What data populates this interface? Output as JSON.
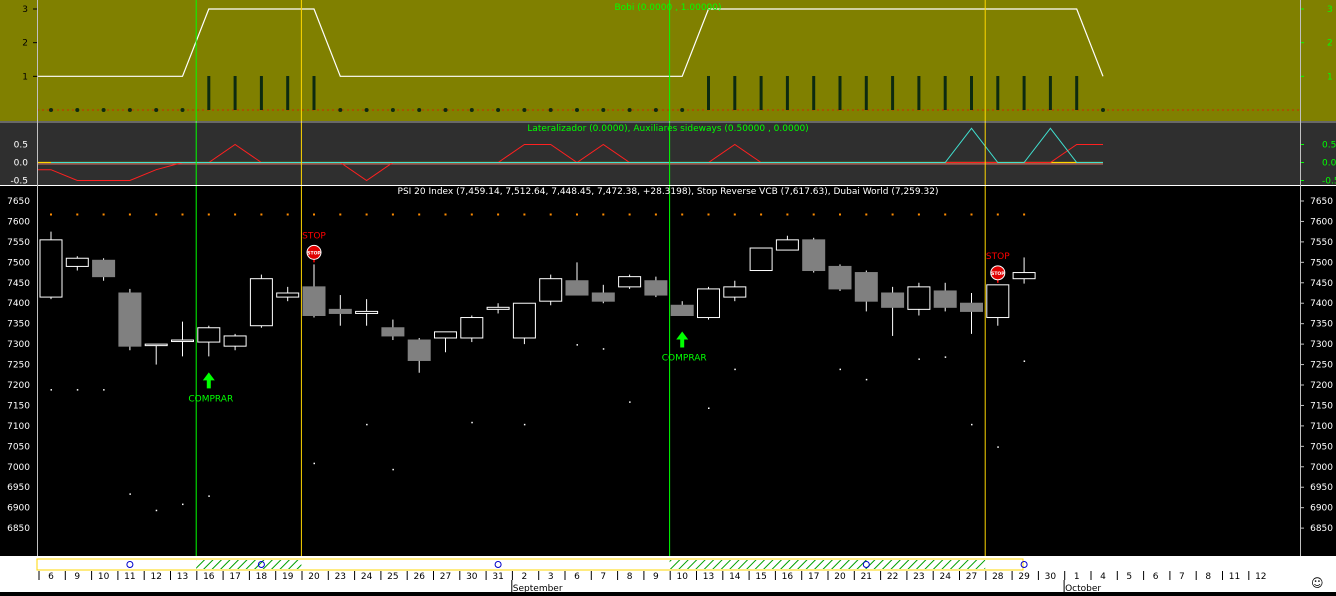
{
  "colors": {
    "panel1_bg": "#808000",
    "panel2_bg": "#2f2f2f",
    "main_bg": "#000000",
    "buy_line": "#00ff00",
    "stop_line": "#ffd700",
    "up_candle": "#ffffff",
    "down_candle": "#808080",
    "signal_text_buy": "#00ff00",
    "signal_text_stop": "#ff0000",
    "osc_red": "#ff2020",
    "osc_cyan": "#40e0d0",
    "dotted_orange": "#ff8c00"
  },
  "chart_data": [
    {
      "id": "bobi",
      "type": "line",
      "title": "Bobi (0.0000 , 1.00000)",
      "ylim": [
        0,
        3
      ],
      "yticks": [
        "1",
        "2",
        "3"
      ],
      "step_line": [
        1,
        1,
        1,
        1,
        1,
        1,
        3,
        3,
        3,
        3,
        3,
        1,
        1,
        1,
        1,
        1,
        1,
        1,
        1,
        1,
        1,
        1,
        1,
        1,
        1,
        3,
        3,
        3,
        3,
        3,
        3,
        3,
        3,
        3,
        3,
        3,
        3,
        3,
        3,
        3,
        1
      ],
      "bars": [
        0,
        0,
        0,
        0,
        0,
        0,
        1,
        1,
        1,
        1,
        1,
        0,
        0,
        0,
        0,
        0,
        0,
        0,
        0,
        0,
        0,
        0,
        0,
        0,
        0,
        1,
        1,
        1,
        1,
        1,
        1,
        1,
        1,
        1,
        1,
        1,
        1,
        1,
        1,
        1,
        0
      ]
    },
    {
      "id": "lateralizador",
      "type": "line",
      "title": "Lateralizador (0.0000), Auxiliares sideways (0.50000 , 0.0000)",
      "ylim": [
        -0.5,
        0.75
      ],
      "yticks": [
        "-0.5",
        "0.0",
        "0.5"
      ],
      "series": [
        {
          "values": [
            -0.2,
            -0.5,
            -0.5,
            -0.5,
            -0.2,
            0,
            0,
            0.5,
            0,
            0,
            0,
            0,
            -0.5,
            0,
            0,
            0,
            0,
            0,
            0.5,
            0.5,
            0,
            0.5,
            0,
            0,
            0,
            0,
            0.5,
            0,
            0,
            0,
            0,
            0,
            0,
            0,
            0,
            0,
            0,
            0,
            0,
            0.5,
            0.5
          ]
        },
        {
          "values": [
            0,
            0,
            0,
            0,
            0,
            0,
            0,
            0,
            0,
            0,
            0,
            0,
            0,
            0,
            0,
            0,
            0,
            0,
            0,
            0,
            0,
            0,
            0,
            0,
            0,
            0,
            0,
            0,
            0,
            0,
            0,
            0,
            0,
            0,
            0,
            1,
            0,
            0,
            1,
            0,
            0
          ]
        }
      ]
    },
    {
      "id": "price",
      "type": "candlestick",
      "title": "PSI 20 Index (7,459.14, 7,512.64, 7,448.45, 7,472.38, +28.3198), Stop Reverse VCB (7,617.63), Dubai World (7,259.32)",
      "ylim": [
        6800,
        7690
      ],
      "yticks": [
        "6850",
        "6900",
        "6950",
        "7000",
        "7050",
        "7100",
        "7150",
        "7200",
        "7250",
        "7300",
        "7350",
        "7400",
        "7450",
        "7500",
        "7550",
        "7600",
        "7650"
      ],
      "candles": [
        {
          "o": 7415,
          "h": 7575,
          "l": 7410,
          "c": 7555
        },
        {
          "o": 7490,
          "h": 7515,
          "l": 7480,
          "c": 7510
        },
        {
          "o": 7505,
          "h": 7510,
          "l": 7455,
          "c": 7465
        },
        {
          "o": 7425,
          "h": 7435,
          "l": 7285,
          "c": 7295
        },
        {
          "o": 7300,
          "h": 7300,
          "l": 7250,
          "c": 7300
        },
        {
          "o": 7310,
          "h": 7355,
          "l": 7270,
          "c": 7310
        },
        {
          "o": 7305,
          "h": 7345,
          "l": 7270,
          "c": 7340
        },
        {
          "o": 7295,
          "h": 7325,
          "l": 7285,
          "c": 7320
        },
        {
          "o": 7345,
          "h": 7470,
          "l": 7340,
          "c": 7460
        },
        {
          "o": 7415,
          "h": 7440,
          "l": 7405,
          "c": 7425
        },
        {
          "o": 7440,
          "h": 7495,
          "l": 7365,
          "c": 7370
        },
        {
          "o": 7385,
          "h": 7420,
          "l": 7345,
          "c": 7375
        },
        {
          "o": 7375,
          "h": 7410,
          "l": 7345,
          "c": 7380
        },
        {
          "o": 7340,
          "h": 7360,
          "l": 7310,
          "c": 7320
        },
        {
          "o": 7310,
          "h": 7315,
          "l": 7230,
          "c": 7260
        },
        {
          "o": 7315,
          "h": 7330,
          "l": 7280,
          "c": 7330
        },
        {
          "o": 7315,
          "h": 7370,
          "l": 7305,
          "c": 7365
        },
        {
          "o": 7385,
          "h": 7400,
          "l": 7375,
          "c": 7390
        },
        {
          "o": 7315,
          "h": 7400,
          "l": 7300,
          "c": 7400
        },
        {
          "o": 7405,
          "h": 7470,
          "l": 7395,
          "c": 7460
        },
        {
          "o": 7455,
          "h": 7500,
          "l": 7420,
          "c": 7420
        },
        {
          "o": 7425,
          "h": 7445,
          "l": 7400,
          "c": 7405
        },
        {
          "o": 7440,
          "h": 7470,
          "l": 7435,
          "c": 7465
        },
        {
          "o": 7455,
          "h": 7465,
          "l": 7415,
          "c": 7420
        },
        {
          "o": 7395,
          "h": 7405,
          "l": 7370,
          "c": 7370
        },
        {
          "o": 7365,
          "h": 7440,
          "l": 7360,
          "c": 7435
        },
        {
          "o": 7415,
          "h": 7455,
          "l": 7405,
          "c": 7440
        },
        {
          "o": 7480,
          "h": 7535,
          "l": 7480,
          "c": 7535
        },
        {
          "o": 7530,
          "h": 7565,
          "l": 7530,
          "c": 7555
        },
        {
          "o": 7555,
          "h": 7560,
          "l": 7475,
          "c": 7480
        },
        {
          "o": 7490,
          "h": 7495,
          "l": 7430,
          "c": 7435
        },
        {
          "o": 7475,
          "h": 7480,
          "l": 7380,
          "c": 7405
        },
        {
          "o": 7425,
          "h": 7440,
          "l": 7320,
          "c": 7390
        },
        {
          "o": 7385,
          "h": 7450,
          "l": 7370,
          "c": 7440
        },
        {
          "o": 7430,
          "h": 7450,
          "l": 7380,
          "c": 7390
        },
        {
          "o": 7400,
          "h": 7425,
          "l": 7325,
          "c": 7380
        },
        {
          "o": 7365,
          "h": 7445,
          "l": 7345,
          "c": 7445
        },
        {
          "o": 7460,
          "h": 7512,
          "l": 7448,
          "c": 7475
        }
      ],
      "stop_dots_value": 7617,
      "scatter_dots": [
        {
          "i": 0,
          "v": 7190
        },
        {
          "i": 1,
          "v": 7190
        },
        {
          "i": 2,
          "v": 7190
        },
        {
          "i": 3,
          "v": 6935
        },
        {
          "i": 4,
          "v": 6895
        },
        {
          "i": 5,
          "v": 6910
        },
        {
          "i": 6,
          "v": 6930
        },
        {
          "i": 10,
          "v": 7010
        },
        {
          "i": 12,
          "v": 7105
        },
        {
          "i": 13,
          "v": 6995
        },
        {
          "i": 16,
          "v": 7110
        },
        {
          "i": 18,
          "v": 7105
        },
        {
          "i": 20,
          "v": 7300
        },
        {
          "i": 21,
          "v": 7290
        },
        {
          "i": 22,
          "v": 7160
        },
        {
          "i": 25,
          "v": 7145
        },
        {
          "i": 26,
          "v": 7240
        },
        {
          "i": 30,
          "v": 7240
        },
        {
          "i": 31,
          "v": 7215
        },
        {
          "i": 33,
          "v": 7265
        },
        {
          "i": 34,
          "v": 7270
        },
        {
          "i": 35,
          "v": 7105
        },
        {
          "i": 36,
          "v": 7050
        },
        {
          "i": 37,
          "v": 7260
        }
      ],
      "buy_signals": [
        {
          "i": 6,
          "label": "COMPRAR"
        },
        {
          "i": 24,
          "label": "COMPRAR"
        }
      ],
      "stop_signals": [
        {
          "i": 10,
          "label": "STOP",
          "badge": "STOP"
        },
        {
          "i": 36,
          "label": "STOP",
          "badge": "STOP"
        }
      ]
    }
  ],
  "x_axis": {
    "ticks": [
      "6",
      "9",
      "10",
      "11",
      "12",
      "13",
      "16",
      "17",
      "18",
      "19",
      "20",
      "23",
      "24",
      "25",
      "26",
      "27",
      "30",
      "31",
      "2",
      "3",
      "6",
      "7",
      "8",
      "9",
      "10",
      "13",
      "14",
      "15",
      "16",
      "17",
      "20",
      "21",
      "22",
      "23",
      "24",
      "27",
      "28",
      "29",
      "30",
      "1",
      "4",
      "5",
      "6",
      "7",
      "8",
      "11",
      "12"
    ],
    "months": [
      "September",
      "October"
    ]
  }
}
